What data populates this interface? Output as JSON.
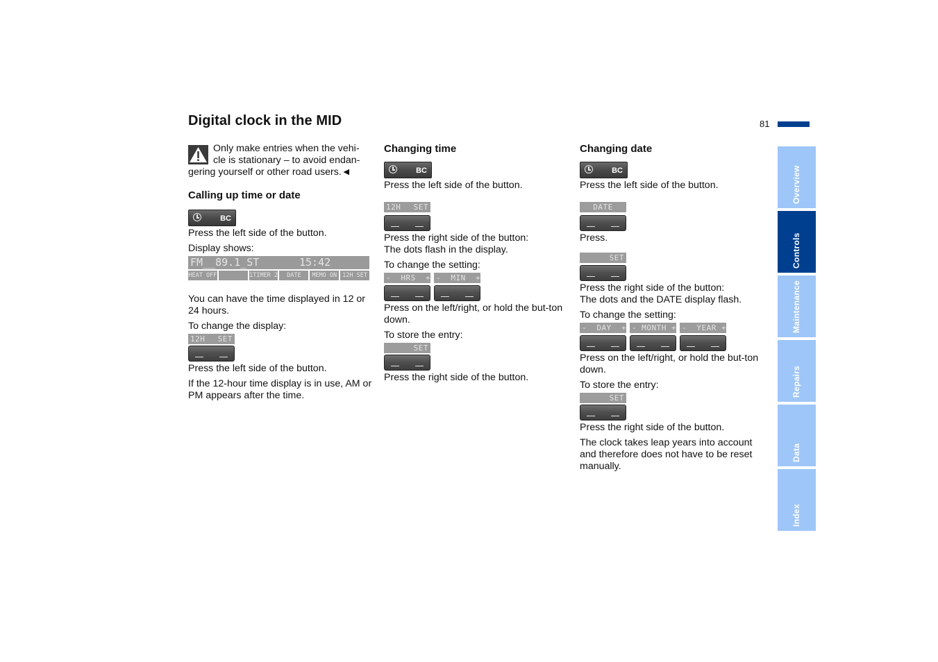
{
  "page": {
    "title": "Digital clock in the MID",
    "page_number": "81",
    "accent_color": "#003f8f",
    "tab_inactive_color": "#9ec6f8"
  },
  "tabs": [
    {
      "label": "Overview",
      "active": false
    },
    {
      "label": "Controls",
      "active": true
    },
    {
      "label": "Maintenance",
      "active": false
    },
    {
      "label": "Repairs",
      "active": false
    },
    {
      "label": "Data",
      "active": false
    },
    {
      "label": "Index",
      "active": false
    }
  ],
  "col1": {
    "warning_icon": "warning-triangle-icon",
    "warning_text": "Only make entries when the vehi-cle is stationary – to avoid endan-gering yourself or other road users.◄",
    "warning_line1": "Only make entries when the vehi-",
    "warning_line2": "cle is stationary – to avoid endan-",
    "warning_line3": "gering yourself or other road users.◄",
    "heading": "Calling up time or date",
    "bc_button_label": "BC",
    "bc_button_icon": "clock-icon",
    "p1": "Press the left side of the button.",
    "p2": "Display shows:",
    "display": {
      "top_left": "FM__89.1_ST",
      "top_time": "15:42",
      "bottom": [
        "HEAT OFF",
        "",
        "1TIMER 2",
        "DATE",
        "MEMO ON",
        "12H SET"
      ]
    },
    "p3": "You can have the time displayed in 12 or 24 hours.",
    "p4": "To change the display:",
    "lcd_12h": "12H",
    "lcd_set": "SET",
    "p5": "Press the left side of the button.",
    "p6": "If the 12-hour time display is in use, AM or PM appears after the time."
  },
  "col2": {
    "heading": "Changing time",
    "bc_button_label": "BC",
    "p1": "Press the left side of the button.",
    "lcd_12h": "12H",
    "lcd_set": "SET",
    "p2_line1": "Press the right side of the button:",
    "p2_line2": "The dots flash in the display.",
    "p3": "To change the setting:",
    "lcd_hrs": "-  HRS  +",
    "lcd_min": "-  MIN  +",
    "p4": "Press on the left/right, or hold the but-ton down.",
    "p5": "To store the entry:",
    "lcd_store_set": "SET",
    "p6": "Press the right side of the button."
  },
  "col3": {
    "heading": "Changing date",
    "bc_button_label": "BC",
    "p1": "Press the left side of the button.",
    "lcd_date": "DATE",
    "p2": "Press.",
    "lcd_set": "SET",
    "p3_line1": "Press the right side of the button:",
    "p3_line2": "The dots and the DATE display flash.",
    "p4": "To change the setting:",
    "lcd_day": "-  DAY  +",
    "lcd_month": "- MONTH +",
    "lcd_year": "-  YEAR +",
    "p5": "Press on the left/right, or hold the but-ton down.",
    "p6": "To store the entry:",
    "lcd_store_set": "SET",
    "p7": "Press the right side of the button.",
    "p8": "The clock takes leap years into account and therefore does not have to be reset manually."
  }
}
